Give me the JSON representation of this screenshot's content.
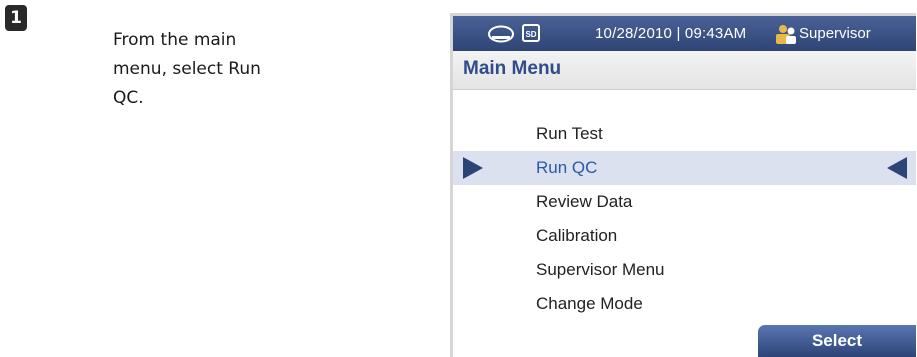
{
  "step": {
    "number": "1",
    "instruction": "From the main menu, select Run QC."
  },
  "status_bar": {
    "datetime": "10/28/2010 | 09:43AM",
    "user": "Supervisor"
  },
  "title": "Main Menu",
  "menu": {
    "items": [
      {
        "label": "Run Test"
      },
      {
        "label": "Run QC"
      },
      {
        "label": "Review Data"
      },
      {
        "label": "Calibration"
      },
      {
        "label": "Supervisor Menu"
      },
      {
        "label": "Change Mode"
      }
    ],
    "selected": "Run QC"
  },
  "select_label": "Select",
  "icons": {
    "device": "card-reader-icon",
    "storage": "sd-card-icon",
    "user": "user-group-icon"
  },
  "colors": {
    "header": "#2e4474",
    "title": "#2f4d8a",
    "selected_bg": "#dce1ef",
    "selected_text": "#2a5aa8"
  }
}
